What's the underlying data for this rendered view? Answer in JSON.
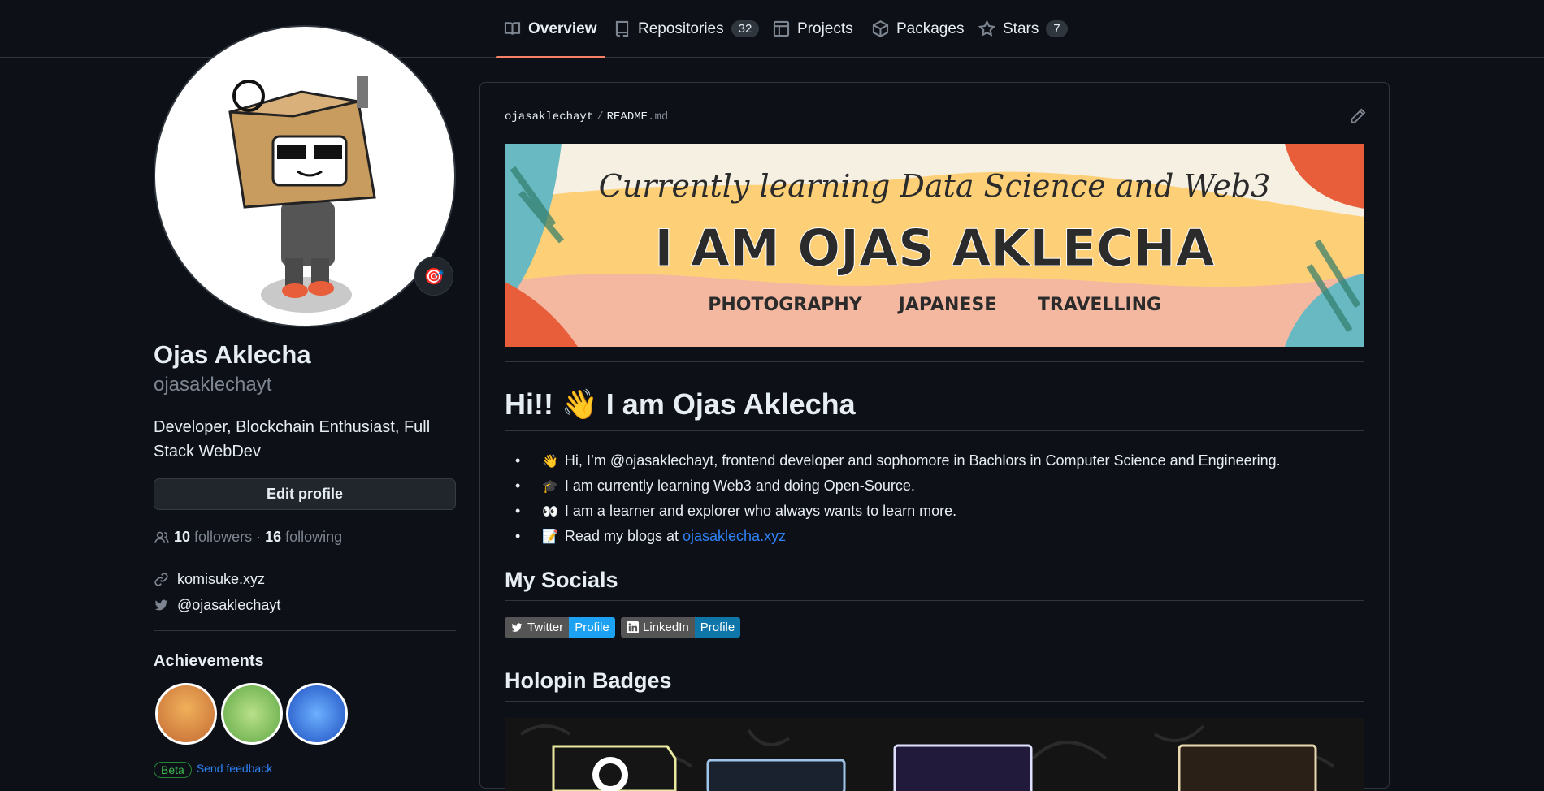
{
  "nav": {
    "tabs": [
      {
        "label": "Overview",
        "icon": "book-icon"
      },
      {
        "label": "Repositories",
        "icon": "repo-icon",
        "count": "32"
      },
      {
        "label": "Projects",
        "icon": "table-icon"
      },
      {
        "label": "Packages",
        "icon": "package-icon"
      },
      {
        "label": "Stars",
        "icon": "star-icon",
        "count": "7"
      }
    ]
  },
  "profile": {
    "name": "Ojas Aklecha",
    "login": "ojasaklechayt",
    "bio": "Developer, Blockchain Enthusiast, Full Stack WebDev",
    "edit_label": "Edit profile",
    "followers_count": "10",
    "followers_label": "followers",
    "following_count": "16",
    "following_label": "following",
    "website": "komisuke.xyz",
    "twitter": "@ojasaklechayt",
    "achievements_title": "Achievements",
    "beta_label": "Beta",
    "feedback_label": "Send feedback"
  },
  "readme": {
    "owner": "ojasaklechayt",
    "file": "README",
    "ext": ".md",
    "banner": {
      "tagline": "Currently learning Data Science and Web3",
      "headline": "I AM OJAS AKLECHA",
      "hobbies": [
        "PHOTOGRAPHY",
        "JAPANESE",
        "TRAVELLING"
      ]
    },
    "heading": "Hi!! 👋 I am Ojas Aklecha",
    "bullets": [
      {
        "emoji": "👋",
        "text": "Hi, I’m @ojasaklechayt, frontend developer and sophomore in Bachlors in Computer Science and Engineering."
      },
      {
        "emoji": "🎓",
        "text": "I am currently learning Web3 and doing Open-Source."
      },
      {
        "emoji": "👀",
        "text": "I am a learner and explorer who always wants to learn more."
      },
      {
        "emoji": "📝",
        "text": "Read my blogs at",
        "link": "ojasaklecha.xyz"
      }
    ],
    "socials_heading": "My Socials",
    "socials": [
      {
        "left": "Twitter",
        "right": "Profile",
        "color": "#1DA1F2"
      },
      {
        "left": "LinkedIn",
        "right": "Profile",
        "color": "#0e76a8"
      }
    ],
    "holopin_heading": "Holopin Badges"
  },
  "colors": {
    "accent": "#f78166",
    "link": "#2f81f7",
    "bg": "#0d1117",
    "border": "#30363d"
  }
}
